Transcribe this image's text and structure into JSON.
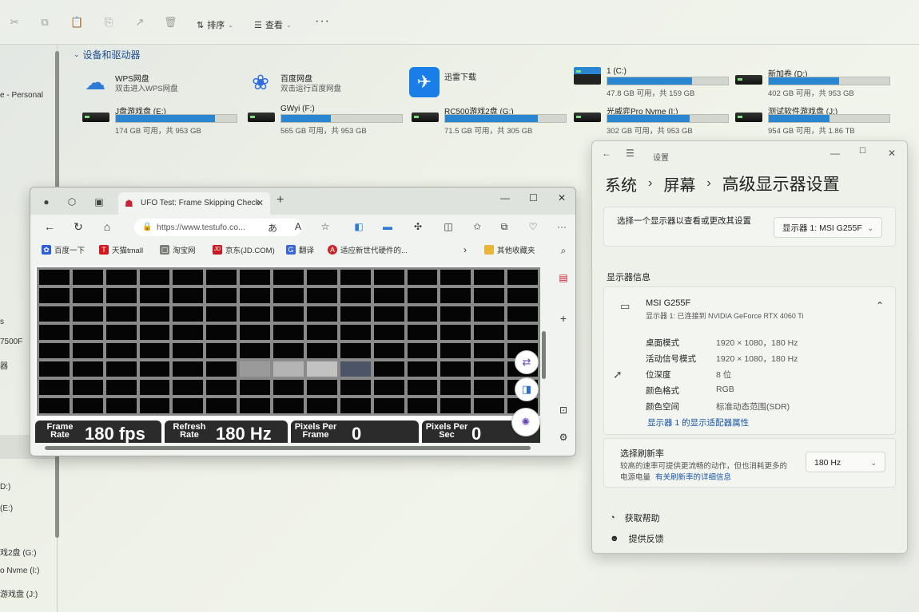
{
  "explorer": {
    "toolbar": {
      "sort_label": "排序",
      "view_label": "查看",
      "more": "···"
    },
    "section_title": "设备和驱动器",
    "left_nav": [
      {
        "label": "e - Personal"
      },
      {
        "label": "s"
      },
      {
        "label": "7500F"
      },
      {
        "label": "器"
      },
      {
        "label": "D:)"
      },
      {
        "label": "(E:)"
      },
      {
        "label": "戏2盘 (G:)"
      },
      {
        "label": "o Nvme (I:)"
      },
      {
        "label": "游戏盘 (J:)"
      }
    ],
    "apps": [
      {
        "name": "WPS网盘",
        "desc": "双击进入WPS网盘",
        "icon": "wps-cloud-icon"
      },
      {
        "name": "百度网盘",
        "desc": "双击运行百度网盘",
        "icon": "baidu-netdisk-icon"
      },
      {
        "name": "迅雷下载",
        "desc": "",
        "icon": "xunlei-icon"
      }
    ],
    "drives": [
      {
        "name": "1 (C:)",
        "info": "47.8 GB 可用，共 159 GB",
        "used_fraction": 0.7
      },
      {
        "name": "新加卷 (D:)",
        "info": "402 GB 可用，共 953 GB",
        "used_fraction": 0.58
      },
      {
        "name": "J盘游戏盘 (E:)",
        "info": "174 GB 可用，共 953 GB",
        "used_fraction": 0.82
      },
      {
        "name": "GWyi (F:)",
        "info": "565 GB 可用，共 953 GB",
        "used_fraction": 0.41
      },
      {
        "name": "RC500游戏2盘 (G:)",
        "info": "71.5 GB 可用，共 305 GB",
        "used_fraction": 0.77
      },
      {
        "name": "光威弈Pro Nvme (I:)",
        "info": "302 GB 可用，共 953 GB",
        "used_fraction": 0.68
      },
      {
        "name": "测试软件游戏盘 (J:)",
        "info": "954 GB 可用，共 1.86 TB",
        "used_fraction": 0.5
      }
    ]
  },
  "browser": {
    "tab_title": "UFO Test: Frame Skipping Check",
    "tab_close": "✕",
    "new_tab": "+",
    "url": "https://www.testufo.co...",
    "favorites": [
      {
        "label": "百度一下",
        "color": "#2b5fd9",
        "glyph": "✿"
      },
      {
        "label": "天猫tmall",
        "color": "#d4161f",
        "glyph": "T"
      },
      {
        "label": "淘宝网",
        "color": "#7a7f77",
        "glyph": "▢"
      },
      {
        "label": "京东(JD.COM)",
        "color": "#c81b21",
        "glyph": "JD"
      },
      {
        "label": "翻译",
        "color": "#3a66d6",
        "glyph": "G"
      },
      {
        "label": "适应新世代硬件的...",
        "color": "#c9252b",
        "glyph": "A"
      }
    ],
    "fav_folder": "其他收藏夹",
    "grid": {
      "columns": 15,
      "rows": 8,
      "lit_row": 5,
      "lit_cells": [
        {
          "col": 6,
          "level": "l1"
        },
        {
          "col": 7,
          "level": "l2"
        },
        {
          "col": 8,
          "level": "l3"
        },
        {
          "col": 9,
          "level": "l4"
        }
      ]
    },
    "stats": [
      {
        "label": "Frame Rate",
        "value": "180 fps"
      },
      {
        "label": "Refresh Rate",
        "value": "180 Hz"
      },
      {
        "label": "Pixels Per Frame",
        "value": "0"
      },
      {
        "label": "Pixels Per Sec",
        "value": "0"
      }
    ]
  },
  "settings": {
    "window_title": "设置",
    "breadcrumb": [
      "系统",
      "屏幕",
      "高级显示器设置"
    ],
    "select_display_label": "选择一个显示器以查看或更改其设置",
    "select_display_value": "显示器 1: MSI G255F",
    "display_info_header": "显示器信息",
    "monitor_name": "MSI G255F",
    "monitor_sub": "显示器 1: 已连接到 NVIDIA GeForce RTX 4060 Ti",
    "info": [
      {
        "key": "桌面模式",
        "value": "1920 × 1080，180 Hz"
      },
      {
        "key": "活动信号模式",
        "value": "1920 × 1080，180 Hz"
      },
      {
        "key": "位深度",
        "value": "8 位"
      },
      {
        "key": "颜色格式",
        "value": "RGB"
      },
      {
        "key": "颜色空间",
        "value": "标准动态范围(SDR)"
      }
    ],
    "adapter_link": "显示器 1 的显示适配器属性",
    "refresh_title": "选择刷新率",
    "refresh_desc_1": "较高的速率可提供更流畅的动作，但也消耗更多的",
    "refresh_desc_2": "电源电量",
    "refresh_link": "有关刷新率的详细信息",
    "refresh_value": "180 Hz",
    "help": "获取帮助",
    "feedback": "提供反馈"
  }
}
